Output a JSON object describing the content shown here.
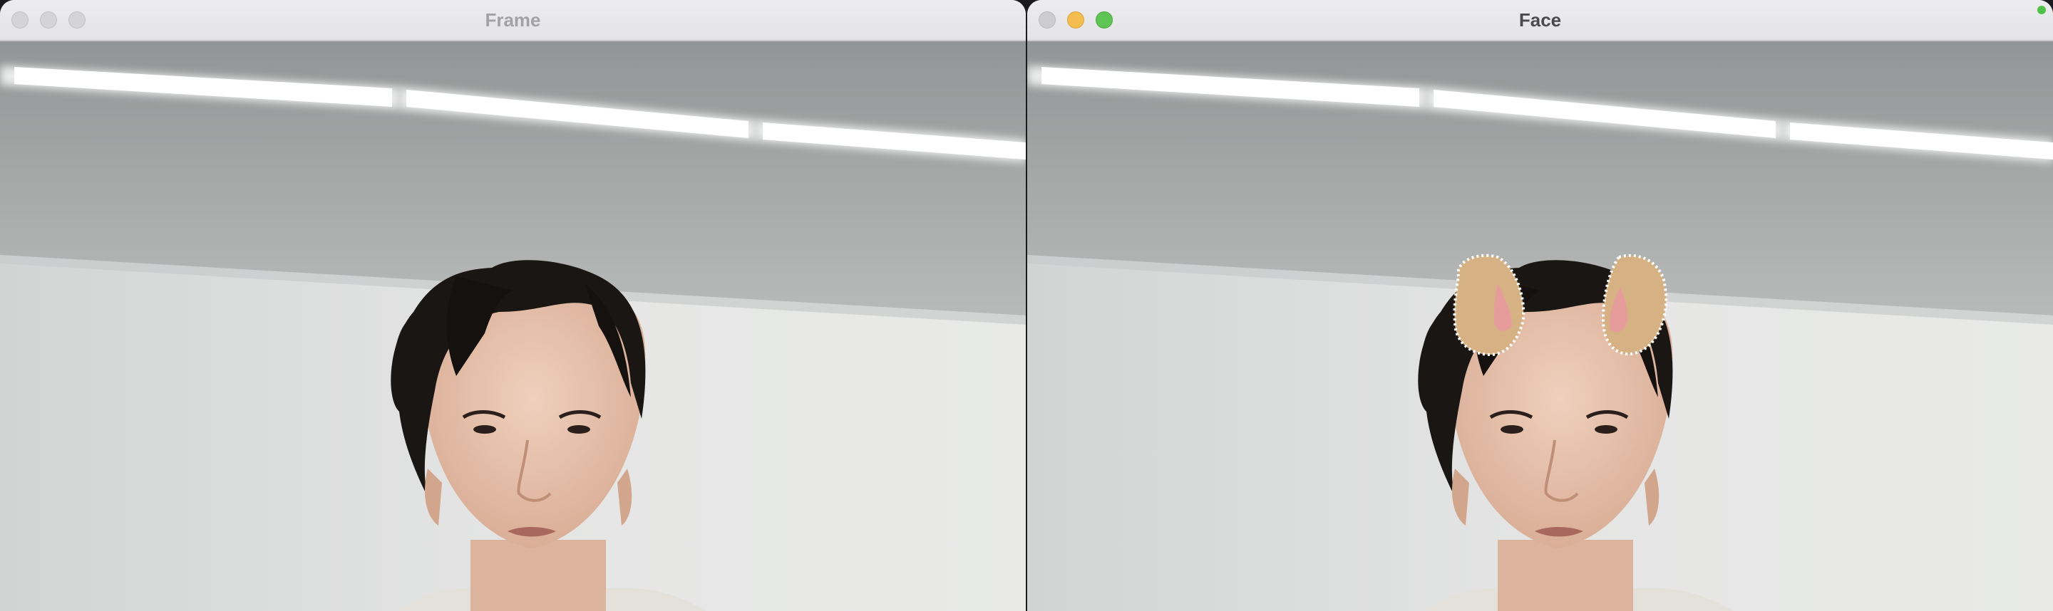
{
  "windows": {
    "left": {
      "title": "Frame"
    },
    "right": {
      "title": "Face"
    }
  },
  "colors": {
    "ear_fill": "#d6b184",
    "ear_inner": "#e79c9c",
    "ceiling": "#a9abab",
    "wall": "#e6e7e6",
    "hair": "#1a1614",
    "skin": "#e9c7b2"
  },
  "icons": [
    "close-icon",
    "minimize-icon",
    "zoom-icon"
  ]
}
